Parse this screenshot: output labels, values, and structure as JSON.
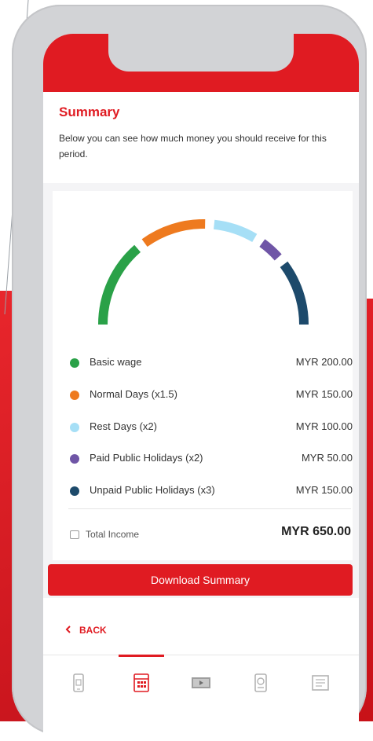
{
  "summary": {
    "title": "Summary",
    "description": "Below you can see how much money you should receive for this period."
  },
  "chart_data": {
    "type": "donut-gauge",
    "currency": "MYR",
    "series": [
      {
        "name": "Basic wage",
        "value": 200.0,
        "display": "MYR 200.00",
        "color": "#2aa148"
      },
      {
        "name": "Normal Days (x1.5)",
        "value": 150.0,
        "display": "MYR 150.00",
        "color": "#ee7a1f"
      },
      {
        "name": "Rest Days (x2)",
        "value": 100.0,
        "display": "MYR 100.00",
        "color": "#a6dff6"
      },
      {
        "name": "Paid Public Holidays (x2)",
        "value": 50.0,
        "display": "MYR 50.00",
        "color": "#6f55a6"
      },
      {
        "name": "Unpaid Public Holidays (x3)",
        "value": 150.0,
        "display": "MYR 150.00",
        "color": "#1d4a6b"
      }
    ]
  },
  "total": {
    "label": "Total Income",
    "value": "MYR 650.00"
  },
  "actions": {
    "download_label": "Download Summary",
    "back_label": "BACK"
  },
  "nav": {
    "items": [
      {
        "icon": "phone-icon",
        "active": false
      },
      {
        "icon": "calculator-icon",
        "active": true
      },
      {
        "icon": "video-icon",
        "active": false
      },
      {
        "icon": "badge-icon",
        "active": false
      },
      {
        "icon": "document-icon",
        "active": false
      }
    ]
  },
  "colors": {
    "brand_red": "#e01b22",
    "phone_frame": "#d2d3d6"
  }
}
